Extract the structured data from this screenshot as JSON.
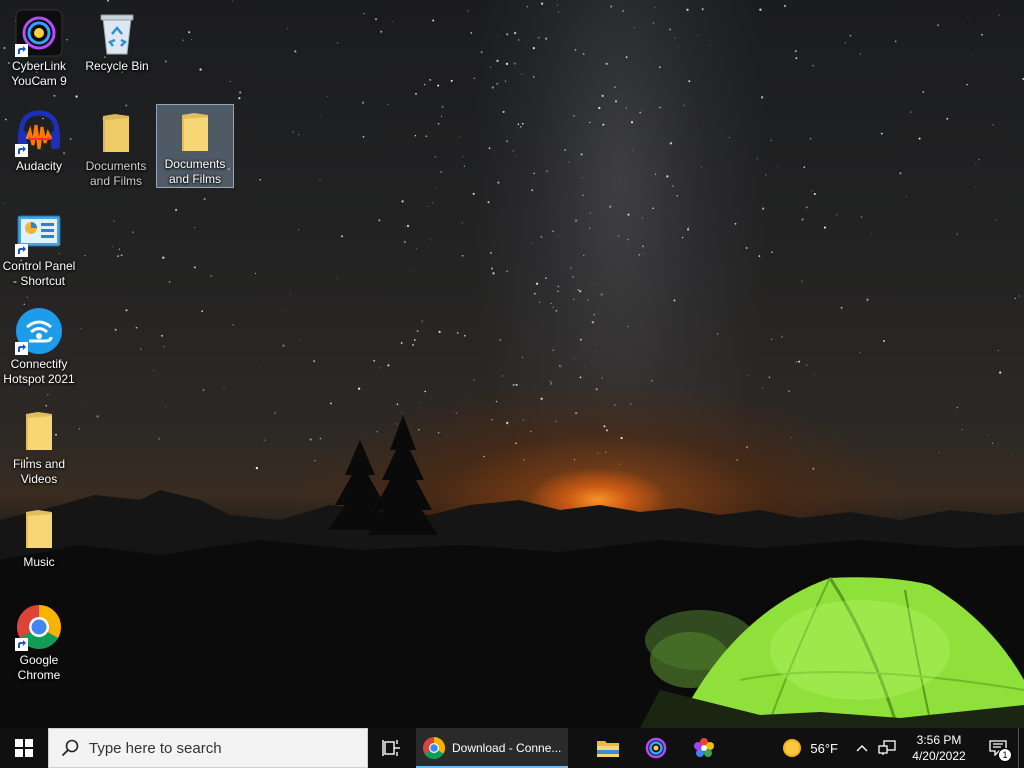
{
  "desktop": {
    "icons": [
      {
        "name": "cyberlink-youcam",
        "label": "CyberLink\nYouCam 9"
      },
      {
        "name": "recycle-bin",
        "label": "Recycle Bin"
      },
      {
        "name": "audacity",
        "label": "Audacity"
      },
      {
        "name": "documents-and-films-1",
        "label": "Documents\nand Films"
      },
      {
        "name": "documents-and-films-2",
        "label": "Documents\nand Films"
      },
      {
        "name": "control-panel-shortcut",
        "label": "Control Panel\n- Shortcut"
      },
      {
        "name": "connectify-hotspot",
        "label": "Connectify\nHotspot 2021"
      },
      {
        "name": "films-and-videos",
        "label": "Films and\nVideos"
      },
      {
        "name": "music",
        "label": "Music"
      },
      {
        "name": "google-chrome",
        "label": "Google\nChrome"
      }
    ],
    "selected_icon": "documents-and-films-2"
  },
  "taskbar": {
    "search_placeholder": "Type here to search",
    "active_window_title": "Download - Conne...",
    "weather_temp": "56°F",
    "clock_time": "3:56 PM",
    "clock_date": "4/20/2022",
    "notification_count": "1"
  },
  "colors": {
    "taskbar_bg": "#101010",
    "active_underline": "#76b9ed",
    "folder_yellow": "#f2cf6b",
    "tent_green": "#8fe03a"
  }
}
